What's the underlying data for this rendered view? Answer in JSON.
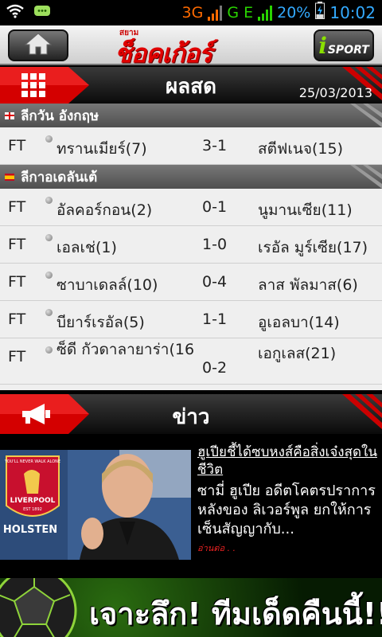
{
  "statusbar": {
    "network_3g": "3G",
    "network_ge": "G E",
    "battery": "20%",
    "time": "10:02"
  },
  "appbar": {
    "logo_small": "สยาม",
    "logo": "ช็อคเก้อร์",
    "isport_i": "i",
    "isport_label": "SPORT"
  },
  "live": {
    "title": "ผลสด",
    "date": "25/03/2013"
  },
  "leagues": [
    {
      "name": "ลีกวัน  อังกฤษ",
      "flag": "england",
      "matches": [
        {
          "status": "FT",
          "home": "ทรานเมียร์(7)",
          "score": "3-1",
          "away": "สตีฟเนจ(15)"
        }
      ]
    },
    {
      "name": "ลีกาอเดลันเต้",
      "flag": "spain",
      "matches": [
        {
          "status": "FT",
          "home": "อัลคอร์กอน(2)",
          "score": "0-1",
          "away": "นูมานเซีย(11)"
        },
        {
          "status": "FT",
          "home": "เอลเช่(1)",
          "score": "1-0",
          "away": "เรอัล มูร์เซีย(17)"
        },
        {
          "status": "FT",
          "home": "ซาบาเดลล์(10)",
          "score": "0-4",
          "away": "ลาส พัลมาส(6)"
        },
        {
          "status": "FT",
          "home": "บียาร์เรอัล(5)",
          "score": "1-1",
          "away": "อูเอลบา(14)"
        },
        {
          "status": "FT",
          "home": "ซ็ดี กัวดาลายาร่า(16",
          "score": "0-2",
          "away": "เอกูเลส(21)"
        }
      ]
    }
  ],
  "news": {
    "title": "ข่าว",
    "headline": "ฮูเปียชี้ได้ซบหงส์คือสิ่งเจ๋งสุดในชีวิต",
    "body": "ซามี่ ฮูเปีย อดีตโคตรปราการหลังของ ลิเวอร์พูล ยกให้การเซ็นสัญญากับ...",
    "more": "อ่านต่อ . .",
    "image_badge_top": "YOU'LL NEVER WALK ALONE",
    "image_badge_club": "LIVERPOOL",
    "image_badge_est": "EST 1892",
    "image_sponsor": "HOLSTEN"
  },
  "banner": {
    "text": "เจาะลึก! ทีมเด็ดคืนนี้!!"
  },
  "colors": {
    "accent_red": "#e00000",
    "header_dark": "#1a1a1a",
    "score_bg": "#efefef",
    "league_bar": "#5f5f5f"
  }
}
